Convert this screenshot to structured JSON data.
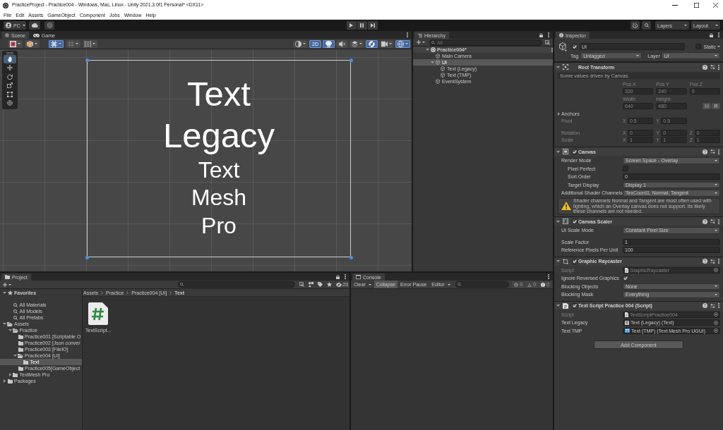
{
  "window": {
    "title": "PracticeProject - Practice004 - Windows, Mac, Linux - Unity 2021.3.0f1 Personal* <DX11>"
  },
  "menu": [
    "File",
    "Edit",
    "Assets",
    "GameObject",
    "Component",
    "Jobs",
    "Window",
    "Help"
  ],
  "toolbar": {
    "account": "PC",
    "play_controls": [
      {
        "kind": "play",
        "on": false
      },
      {
        "kind": "pause",
        "on": false
      },
      {
        "kind": "step",
        "on": false
      }
    ],
    "layers": "Layers",
    "layout": "Layout"
  },
  "scene": {
    "tabs": [
      {
        "label": "Scene",
        "kind": "scene",
        "selected": true
      },
      {
        "label": "Game",
        "kind": "game",
        "selected": false
      }
    ],
    "toolbar_left": [
      {
        "kind": "shading",
        "on": false
      },
      {
        "kind": "gizmo",
        "on": false
      },
      {
        "kind": "grid",
        "on": true
      },
      {
        "kind": "snap",
        "on": false
      },
      {
        "kind": "align",
        "on": false
      }
    ],
    "toolbar_right": [
      {
        "kind": "orientation",
        "on": false
      },
      {
        "kind": "mode2d",
        "label": "2D",
        "on": true
      },
      {
        "kind": "lighting",
        "on": true
      },
      {
        "kind": "audio",
        "on": false
      },
      {
        "kind": "effects",
        "on": false
      },
      {
        "kind": "visibility",
        "on": true
      },
      {
        "kind": "camera",
        "on": false
      },
      {
        "kind": "gizmos",
        "on": true
      }
    ],
    "tools": [
      {
        "kind": "hand",
        "selected": true
      },
      {
        "kind": "move",
        "selected": false
      },
      {
        "kind": "rotate",
        "selected": false
      },
      {
        "kind": "scale",
        "selected": false
      },
      {
        "kind": "rect",
        "selected": false
      },
      {
        "kind": "transform",
        "selected": false
      }
    ],
    "texts": [
      {
        "kind": "legacy",
        "text": "Text Legacy"
      },
      {
        "kind": "tmp",
        "text": "Text Mesh Pro"
      }
    ]
  },
  "hierarchy": {
    "tab": "Hierarchy",
    "search": {
      "placeholder": "All"
    },
    "items": [
      {
        "label": "Practice004*",
        "kind": "scene",
        "expanded": true,
        "selected": false,
        "children": [
          {
            "label": "Main Camera",
            "kind": "object",
            "selected": false
          },
          {
            "label": "UI",
            "kind": "object",
            "expanded": true,
            "selected": true,
            "children": [
              {
                "label": "Text (Legacy)",
                "kind": "object",
                "selected": false
              },
              {
                "label": "Text (TMP)",
                "kind": "object",
                "selected": false
              }
            ]
          },
          {
            "label": "EventSystem",
            "kind": "object",
            "selected": false
          }
        ]
      }
    ]
  },
  "inspector": {
    "tab": "Inspector",
    "object": {
      "active": true,
      "name": "UI",
      "static": false,
      "static_label": "Static",
      "tag_label": "Tag",
      "tag": "Untagged",
      "layer_label": "Layer",
      "layer": "UI"
    },
    "components": [
      {
        "kind": "recttransform",
        "title": "Rect Transform",
        "expanded": true,
        "note": "Some values driven by Canvas.",
        "rows": [
          {
            "kind": "captions",
            "cells": [
              "Pos X",
              "Pos Y",
              "Pos Z"
            ],
            "disabled": true
          },
          {
            "kind": "fields",
            "cells": [
              "320",
              "240",
              "0"
            ],
            "disabled": true
          },
          {
            "kind": "captions",
            "cells": [
              "Width",
              "Height"
            ],
            "disabled": true
          },
          {
            "kind": "fields",
            "cells": [
              "640",
              "480"
            ],
            "button": "R",
            "disabled": true
          },
          {
            "kind": "foldout",
            "label": "Anchors",
            "expanded": false,
            "disabled": false
          },
          {
            "kind": "vector",
            "label": "Pivot",
            "parts": [
              {
                "axis": "X",
                "value": "0.5"
              },
              {
                "axis": "Y",
                "value": "0.5"
              }
            ],
            "disabled": true
          },
          {
            "kind": "vector",
            "label": "Rotation",
            "parts": [
              {
                "axis": "X",
                "value": "0"
              },
              {
                "axis": "Y",
                "value": "0"
              },
              {
                "axis": "Z",
                "value": "0"
              }
            ],
            "disabled": true
          },
          {
            "kind": "vector",
            "label": "Scale",
            "parts": [
              {
                "axis": "X",
                "value": "1"
              },
              {
                "axis": "Y",
                "value": "1"
              },
              {
                "axis": "Z",
                "value": "1"
              }
            ],
            "disabled": true
          }
        ]
      },
      {
        "kind": "canvas",
        "title": "Canvas",
        "enabled": true,
        "expanded": true,
        "rows": [
          {
            "kind": "dropdown",
            "label": "Render Mode",
            "value": "Screen Space - Overlay",
            "disabled": false,
            "children": [
              {
                "kind": "checkbox",
                "label": "Pixel Perfect",
                "checked": false,
                "disabled": false
              },
              {
                "kind": "number",
                "label": "Sort Order",
                "value": "0",
                "disabled": false
              },
              {
                "kind": "dropdown",
                "label": "Target Display",
                "value": "Display 1",
                "disabled": false
              }
            ]
          },
          {
            "kind": "dropdown",
            "label": "Additional Shader Channels",
            "value": "TexCoord1, Normal, Tangent",
            "disabled": false
          },
          {
            "kind": "warning",
            "text": "Shader channels Normal and Tangent are most often used with lighting, which an Overlay canvas does not support. Its likely these channels are not needed."
          }
        ]
      },
      {
        "kind": "scaler",
        "title": "Canvas Scaler",
        "enabled": true,
        "expanded": true,
        "rows": [
          {
            "kind": "dropdown",
            "label": "UI Scale Mode",
            "value": "Constant Pixel Size",
            "disabled": false
          },
          {
            "kind": "number",
            "label": "Scale Factor",
            "value": "1",
            "disabled": false
          },
          {
            "kind": "number",
            "label": "Reference Pixels Per Unit",
            "value": "100",
            "disabled": false
          }
        ]
      },
      {
        "kind": "raycaster",
        "title": "Graphic Raycaster",
        "enabled": true,
        "expanded": true,
        "rows": [
          {
            "kind": "script",
            "label": "Script",
            "value": "GraphicRaycaster",
            "disabled": true
          },
          {
            "kind": "checkbox",
            "label": "Ignore Reversed Graphics",
            "checked": true,
            "disabled": false
          },
          {
            "kind": "dropdown",
            "label": "Blocking Objects",
            "value": "None",
            "disabled": false
          },
          {
            "kind": "dropdown",
            "label": "Blocking Mask",
            "value": "Everything",
            "disabled": false
          }
        ]
      },
      {
        "kind": "script",
        "title": "Text Script Practice 004 (Script)",
        "enabled": true,
        "expanded": true,
        "rows": [
          {
            "kind": "script",
            "label": "Script",
            "value": "TextScriptPractice004",
            "disabled": true
          },
          {
            "kind": "object",
            "label": "Text Legacy",
            "value": "Text (Legacy) (Text)",
            "disabled": false
          },
          {
            "kind": "tmp",
            "label": "Text TMP",
            "value": "Text (TMP) (Text Mesh Pro UGUI)",
            "disabled": false
          }
        ]
      }
    ],
    "add_button": "Add Component"
  },
  "project": {
    "tab": "Project",
    "hidden_count": "23",
    "tree": [
      {
        "label": "Favorites",
        "kind": "favorites",
        "expanded": true,
        "selected": false,
        "children": [
          {
            "label": "All Materials",
            "kind": "search",
            "selected": false
          },
          {
            "label": "All Models",
            "kind": "search",
            "selected": false
          },
          {
            "label": "All Prefabs",
            "kind": "search",
            "selected": false
          }
        ]
      },
      {
        "label": "Assets",
        "kind": "folder",
        "expanded": true,
        "selected": false,
        "children": [
          {
            "label": "Practice",
            "kind": "folder",
            "expanded": true,
            "selected": false,
            "children": [
              {
                "label": "Practice001 [Scriptable O",
                "kind": "folder",
                "selected": false
              },
              {
                "label": "Practice002 [Json conver",
                "kind": "folder",
                "selected": false
              },
              {
                "label": "Practice003 [FileIO]",
                "kind": "folder",
                "selected": false
              },
              {
                "label": "Practice004 [UI]",
                "kind": "folder",
                "expanded": true,
                "selected": false,
                "children": [
                  {
                    "label": "Text",
                    "kind": "folder",
                    "selected": true
                  }
                ]
              },
              {
                "label": "Practice005[GameObject",
                "kind": "folder",
                "selected": false
              }
            ]
          },
          {
            "label": "TextMesh Pro",
            "kind": "folder",
            "expanded": false,
            "selected": false
          }
        ]
      },
      {
        "label": "Packages",
        "kind": "folder",
        "expanded": false,
        "selected": false
      }
    ],
    "breadcrumb": [
      "Assets",
      "Practice",
      "Practice004 [UI]",
      "Text"
    ],
    "assets": [
      {
        "label": "TextScript...",
        "kind": "script",
        "selected": false
      }
    ]
  },
  "console": {
    "tab": "Console",
    "buttons": [
      {
        "label": "Clear",
        "dropdown": true,
        "on": false
      },
      {
        "label": "Collapse",
        "dropdown": false,
        "on": true
      },
      {
        "label": "Error Pause",
        "dropdown": false,
        "on": false
      },
      {
        "label": "Editor",
        "dropdown": true,
        "on": false
      }
    ],
    "counts": [
      {
        "kind": "error",
        "value": "0"
      },
      {
        "kind": "warning",
        "value": "0"
      },
      {
        "kind": "info",
        "value": "0"
      }
    ]
  }
}
